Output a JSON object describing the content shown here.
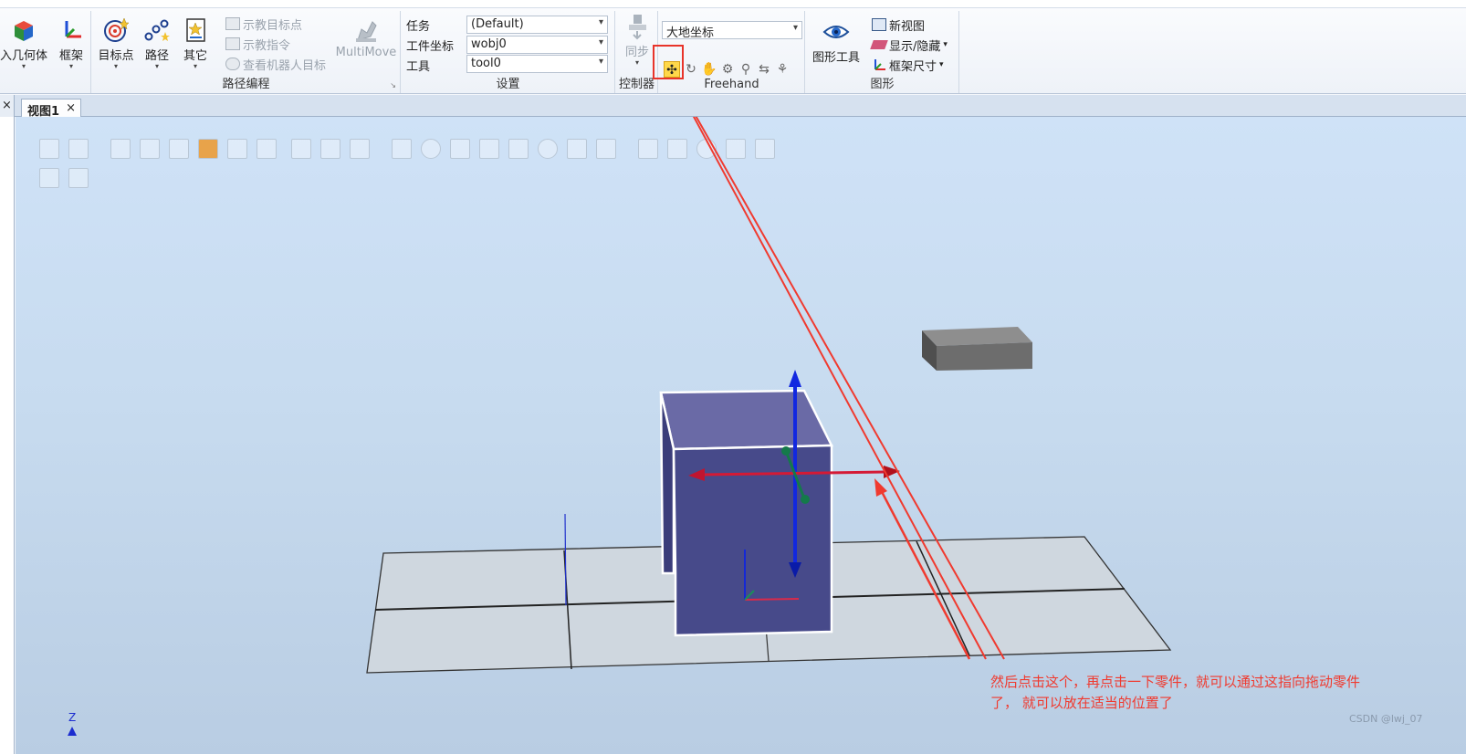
{
  "ribbon": {
    "buttons": {
      "import_geometry": "入几何体",
      "frame": "框架",
      "target": "目标点",
      "path": "路径",
      "other": "其它",
      "teach_target": "示教目标点",
      "teach_instruction": "示教指令",
      "view_robot_target": "查看机器人目标",
      "multimove": "MultiMove",
      "sync": "同步",
      "new_view": "新视图",
      "show_hide": "显示/隐藏",
      "frame_size": "框架尺寸",
      "graphics_tools": "图形工具"
    },
    "groups": {
      "path_programming": "路径编程",
      "settings": "设置",
      "controller": "控制器",
      "freehand": "Freehand",
      "graphics": "图形"
    },
    "settings": {
      "task_label": "任务",
      "task_value": "(Default)",
      "workobj_label": "工件坐标",
      "workobj_value": "wobj0",
      "tool_label": "工具",
      "tool_value": "tool0"
    },
    "freehand": {
      "reference_value": "大地坐标"
    }
  },
  "tabs": {
    "view_tab_label": "视图1",
    "close_glyph": "×"
  },
  "viewport": {
    "z_axis_label": "Z",
    "annotation_line1": "然后点击这个，再点击一下零件，就可以通过这指向拖动零件",
    "annotation_line2": "了， 就可以放在适当的位置了",
    "watermark": "CSDN @lwj_07"
  },
  "colors": {
    "annotation_red": "#f03a2f",
    "selected_part": "#4a4c8e",
    "highlight_button": "#ffd84a"
  }
}
